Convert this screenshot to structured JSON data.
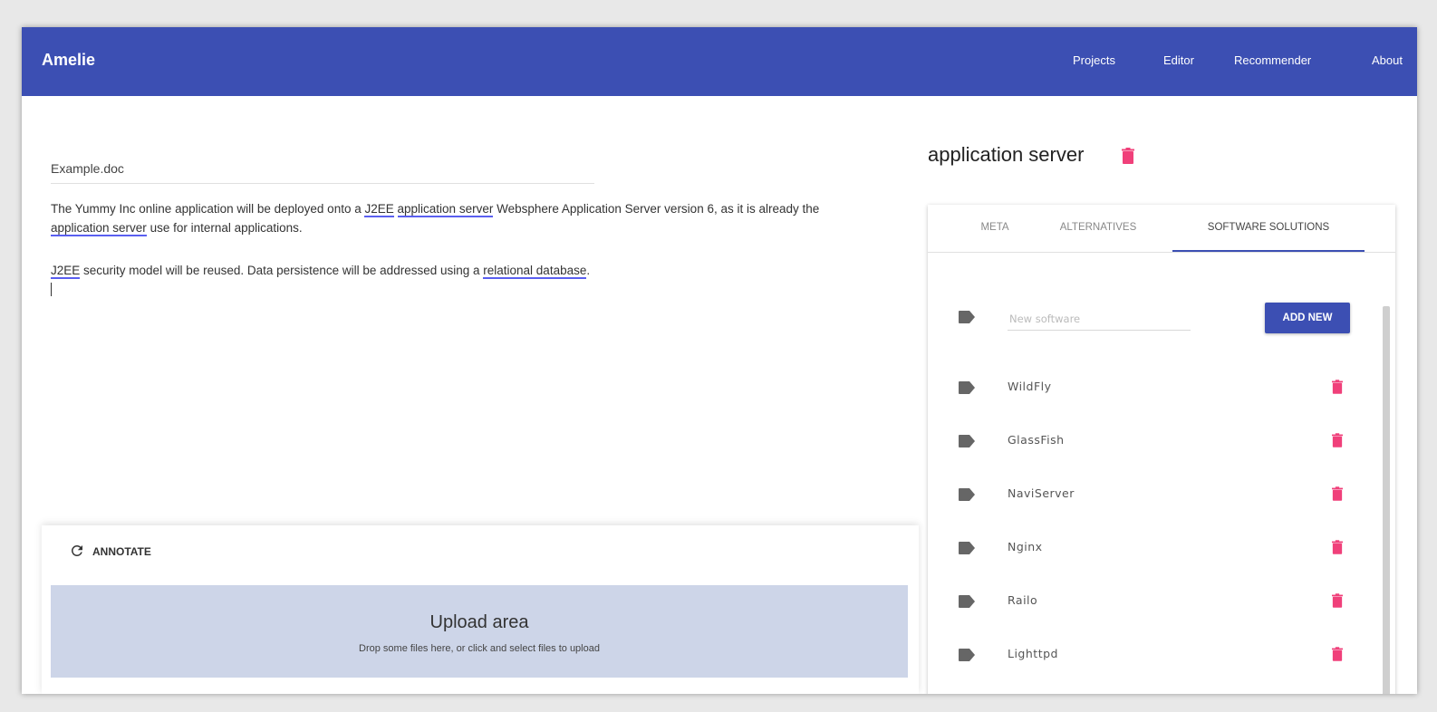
{
  "app": {
    "title": "Amelie",
    "nav": [
      "Projects",
      "Editor",
      "Recommender",
      "About"
    ]
  },
  "editor": {
    "document_name": "Example.doc",
    "paragraph1": {
      "t1": "The Yummy Inc online application will be deployed onto a ",
      "a1": "J2EE",
      "t2": " ",
      "a2": "application server",
      "t3": " Websphere Application Server version 6, as it is already the ",
      "a3": "application server",
      "t4": " use for internal applications."
    },
    "paragraph2": {
      "a1": "J2EE",
      "t1": " security model will be reused. Data persistence will be addressed using a ",
      "a2": "relational database",
      "t2": "."
    }
  },
  "annotate": {
    "button_label": "ANNOTATE",
    "upload_title": "Upload area",
    "upload_hint": "Drop some files here, or click and select files to upload"
  },
  "concept": {
    "title": "application server",
    "tabs": [
      "META",
      "ALTERNATIVES",
      "SOFTWARE SOLUTIONS"
    ],
    "active_tab": "SOFTWARE SOLUTIONS",
    "new_software_placeholder": "New software",
    "add_new_label": "ADD NEW",
    "software": [
      "WildFly",
      "GlassFish",
      "NaviServer",
      "Nginx",
      "Railo",
      "Lighttpd"
    ]
  },
  "colors": {
    "primary": "#3c4fb3",
    "delete": "#f0407a",
    "annotation_underline": "#5a5ff0",
    "upload_bg": "#cdd5e8"
  }
}
